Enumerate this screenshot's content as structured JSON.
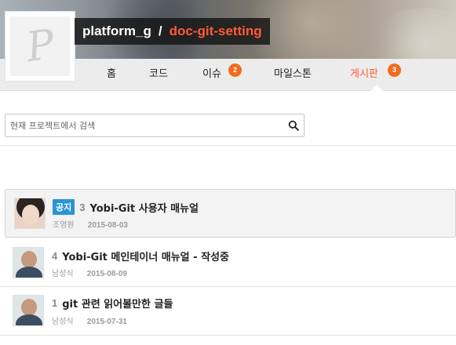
{
  "header": {
    "owner": "platform_g",
    "separator": "/",
    "repo": "doc-git-setting",
    "logo_letter": "P"
  },
  "nav": {
    "items": [
      {
        "label": "홈"
      },
      {
        "label": "코드"
      },
      {
        "label": "이슈",
        "badge": "2"
      },
      {
        "label": "마일스톤"
      },
      {
        "label": "게시판",
        "badge": "3",
        "active": true
      }
    ]
  },
  "search": {
    "placeholder": "현재 프로젝트에서 검색",
    "icon": "search-icon"
  },
  "posts": [
    {
      "notice_label": "공지",
      "number": "3",
      "title": "Yobi-Git 사용자 매뉴얼",
      "author": "조영원",
      "date": "2015-08-03",
      "avatar": "avatar-female"
    },
    {
      "number": "4",
      "title": "Yobi-Git 메인테이너 매뉴얼 - 작성중",
      "author": "남성식",
      "date": "2015-08-09",
      "avatar": "avatar-male"
    },
    {
      "number": "1",
      "title": "git 관련 읽어볼만한 글들",
      "author": "남성식",
      "date": "2015-07-31",
      "avatar": "avatar-male"
    }
  ],
  "colors": {
    "accent": "#ff5a36",
    "badge": "#f26b1d",
    "notice_tag": "#2a94d6"
  }
}
